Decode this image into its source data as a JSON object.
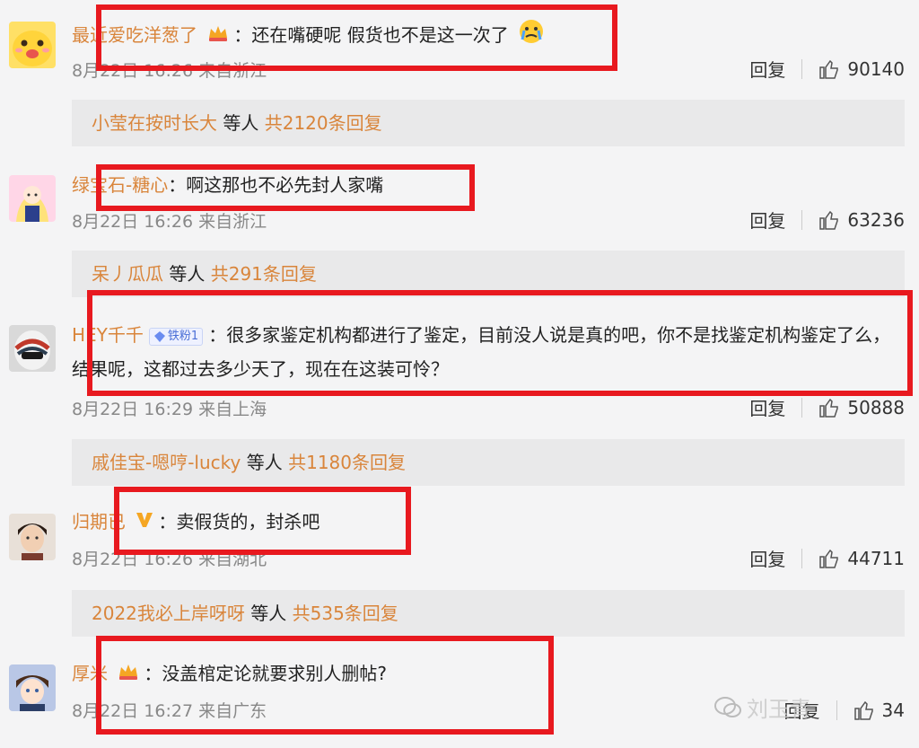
{
  "comments": [
    {
      "username": "最近爱吃洋葱了",
      "colon": "：",
      "text": "还在嘴硬呢 假货也不是这一次了",
      "emoji_icon": "crying-face-icon",
      "time": "8月22日 16:26 来自浙江",
      "reply_label": "回复",
      "likes": "90140",
      "reply_summary": {
        "name": "小莹在按时长大",
        "mid": " 等人 ",
        "total": "共2120条回复"
      }
    },
    {
      "username": "绿宝石-糖心",
      "colon": "：",
      "text": "啊这那也不必先封人家嘴",
      "time": "8月22日 16:26 来自浙江",
      "reply_label": "回复",
      "likes": "63236",
      "reply_summary": {
        "name": "呆丿瓜瓜",
        "mid": " 等人 ",
        "total": "共291条回复"
      }
    },
    {
      "username": "HEY千千",
      "fan_badge": "铁粉1",
      "colon": "：",
      "text": "很多家鉴定机构都进行了鉴定，目前没人说是真的吧，你不是找鉴定机构鉴定了么，结果呢，这都过去多少天了，现在在这装可怜？",
      "time": "8月22日 16:29 来自上海",
      "reply_label": "回复",
      "likes": "50888",
      "reply_summary": {
        "name": "戚佳宝-嗯哼-lucky",
        "mid": " 等人 ",
        "total": "共1180条回复"
      }
    },
    {
      "username": "归期已",
      "colon": "：",
      "text": "卖假货的，封杀吧",
      "time": "8月22日 16:26 来自湖北",
      "reply_label": "回复",
      "likes": "44711",
      "reply_summary": {
        "name": "2022我必上岸呀呀",
        "mid": " 等人 ",
        "total": "共535条回复"
      }
    },
    {
      "username": "厚米",
      "colon": "：",
      "text": "没盖棺定论就要求别人删帖?",
      "time": "8月22日 16:27 来自广东",
      "reply_label": "回复",
      "likes": "34"
    }
  ],
  "watermark": "刘玉青",
  "colors": {
    "username": "#d9853b",
    "highlight_box": "#e8191f",
    "vip": "#f5a623"
  }
}
